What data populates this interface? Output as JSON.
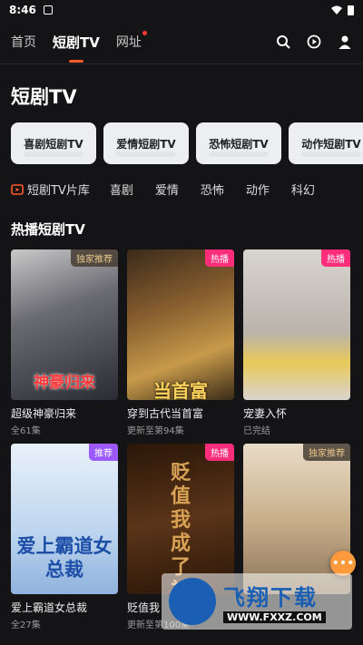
{
  "status": {
    "time": "8:46"
  },
  "topnav": {
    "tabs": [
      "首页",
      "短剧TV",
      "网址"
    ]
  },
  "section_title": "短剧TV",
  "pills": [
    "喜剧短剧TV",
    "爱情短剧TV",
    "恐怖短剧TV",
    "动作短剧TV"
  ],
  "categories": {
    "first": "短剧TV片库",
    "items": [
      "喜剧",
      "爱情",
      "恐怖",
      "动作",
      "科幻"
    ]
  },
  "hot_title": "热播短剧TV",
  "cards": [
    {
      "title": "超级神豪归来",
      "sub": "全61集",
      "badge": "独家推荐",
      "poster_text": "神豪归来"
    },
    {
      "title": "穿到古代当首富",
      "sub": "更新至第94集",
      "badge": "热播",
      "poster_text": "当首富"
    },
    {
      "title": "宠妻入怀",
      "sub": "已完结",
      "badge": "热播",
      "poster_text": ""
    },
    {
      "title": "爱上霸道女总裁",
      "sub": "全27集",
      "badge": "推荐",
      "poster_text": "爱上霸道女总裁"
    },
    {
      "title": "贬值我",
      "sub": "更新至第100集",
      "badge": "热播",
      "poster_text": "贬值我成了神豪"
    },
    {
      "title": "",
      "sub": "",
      "badge": "独家推荐",
      "poster_text": ""
    }
  ],
  "watermark": {
    "big": "飞翔下载",
    "small": "WWW.FXXZ.COM"
  },
  "colors": {
    "accent": "#ff5a2a",
    "background": "#141416",
    "badge_pink": "#ff2d7a"
  }
}
